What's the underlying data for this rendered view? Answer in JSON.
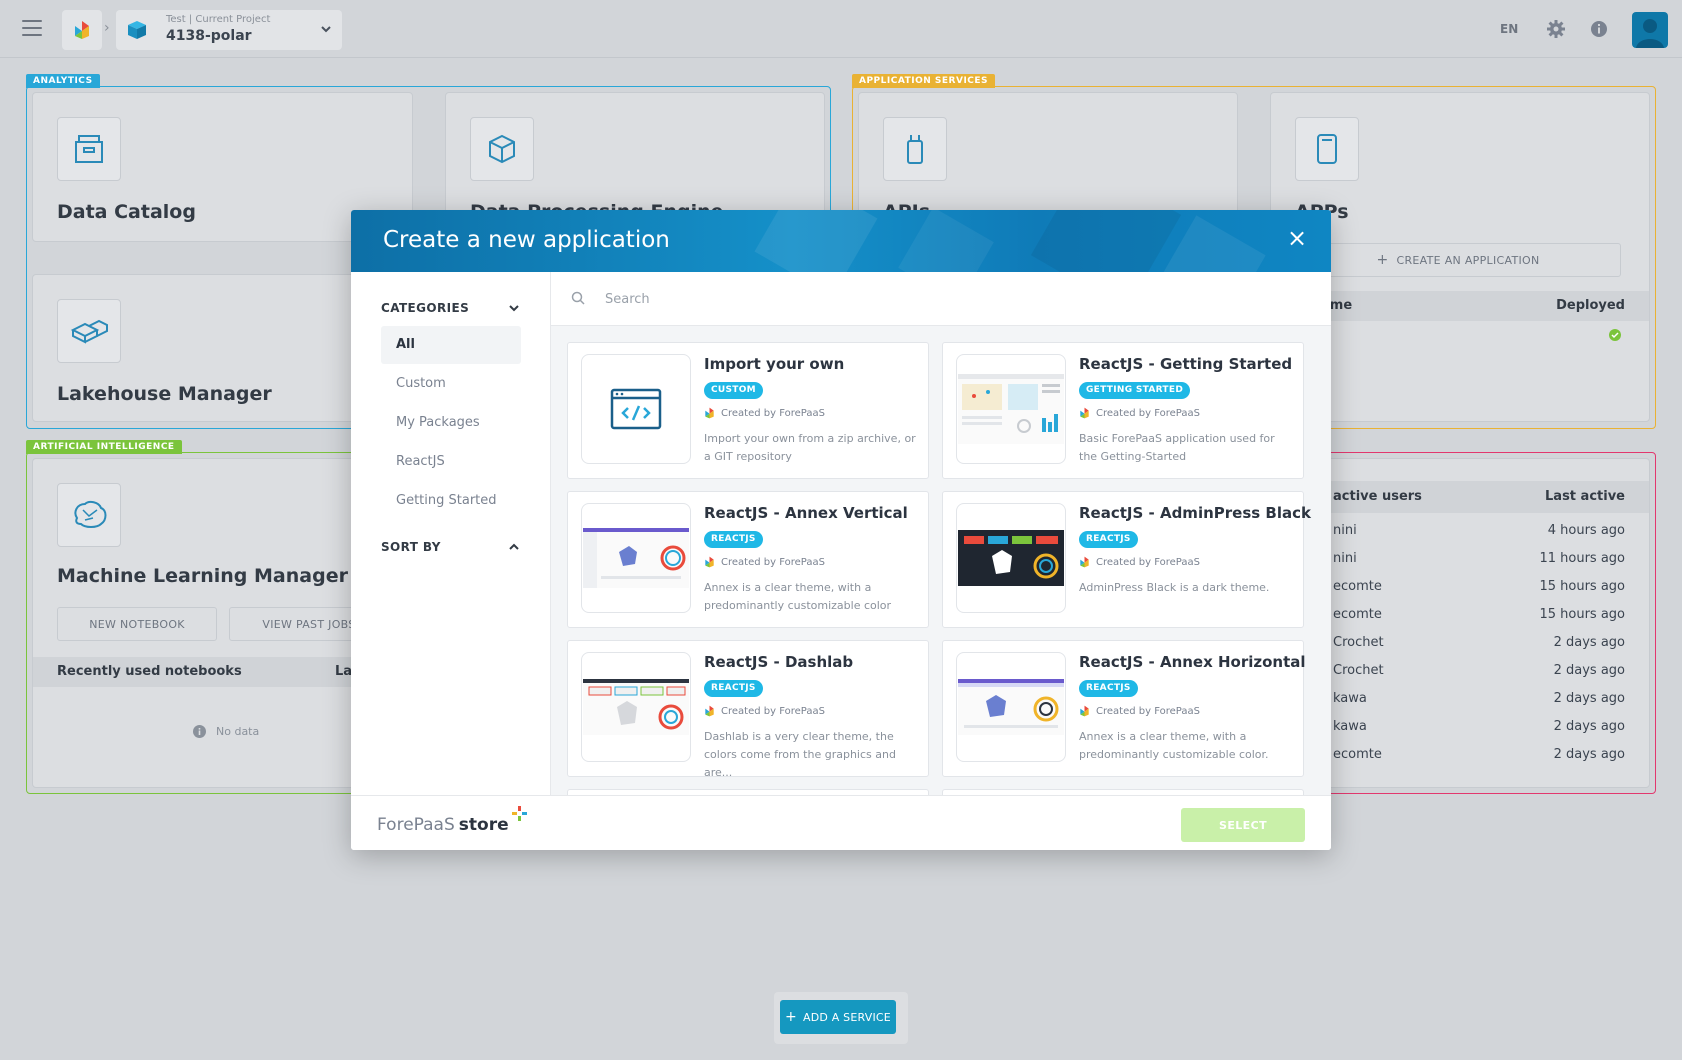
{
  "topbar": {
    "project_sub": "Test | Current Project",
    "project_name": "4138-polar",
    "lang": "EN"
  },
  "sections": {
    "analytics_tag": "ANALYTICS",
    "app_services_tag": "APPLICATION SERVICES",
    "ai_tag": "ARTIFICIAL INTELLIGENCE"
  },
  "cards": {
    "data_catalog": "Data Catalog",
    "data_processing": "Data Processing Engine",
    "lakehouse": "Lakehouse Manager",
    "apis": "APIs",
    "apps": "APPs",
    "create_app_label": "CREATE AN APPLICATION",
    "apps_table_name": "ame",
    "apps_table_deployed": "Deployed",
    "ml_manager": "Machine Learning Manager",
    "new_notebook": "NEW NOTEBOOK",
    "view_past_jobs": "VIEW PAST JOBS",
    "recent_notebooks": "Recently used notebooks",
    "recent_notebooks_col2": "La",
    "no_data": "No data"
  },
  "users": {
    "col_users": "active users",
    "col_last": "Last active",
    "rows": [
      {
        "name": "nini",
        "last": "4 hours ago"
      },
      {
        "name": "nini",
        "last": "11 hours ago"
      },
      {
        "name": "ecomte",
        "last": "15 hours ago"
      },
      {
        "name": "ecomte",
        "last": "15 hours ago"
      },
      {
        "name": "Crochet",
        "last": "2 days ago"
      },
      {
        "name": "Crochet",
        "last": "2 days ago"
      },
      {
        "name": "kawa",
        "last": "2 days ago"
      },
      {
        "name": "kawa",
        "last": "2 days ago"
      },
      {
        "name": "ecomte",
        "last": "2 days ago"
      }
    ]
  },
  "add_service": "ADD A SERVICE",
  "modal": {
    "title": "Create a new application",
    "categories_label": "CATEGORIES",
    "categories": [
      "All",
      "Custom",
      "My Packages",
      "ReactJS",
      "Getting Started"
    ],
    "sort_by_label": "SORT BY",
    "search_placeholder": "Search",
    "apps": [
      {
        "name": "Import your own",
        "badge": "CUSTOM",
        "author": "Created by ForePaaS",
        "desc": "Import your own from a zip archive, or a GIT repository"
      },
      {
        "name": "ReactJS - Getting Started",
        "badge": "GETTING STARTED",
        "author": "Created by ForePaaS",
        "desc": "Basic ForePaaS application used for the Getting-Started"
      },
      {
        "name": "ReactJS - Annex Vertical",
        "badge": "REACTJS",
        "author": "Created by ForePaaS",
        "desc": "Annex is a clear theme, with a predominantly customizable color"
      },
      {
        "name": "ReactJS - AdminPress Black",
        "badge": "REACTJS",
        "author": "Created by ForePaaS",
        "desc": "AdminPress Black is a dark theme."
      },
      {
        "name": "ReactJS - Dashlab",
        "badge": "REACTJS",
        "author": "Created by ForePaaS",
        "desc": "Dashlab is a very clear theme, the colors come from the graphics and are..."
      },
      {
        "name": "ReactJS - Annex Horizontal",
        "badge": "REACTJS",
        "author": "Created by ForePaaS",
        "desc": "Annex is a clear theme, with a predominantly customizable color."
      }
    ],
    "footer_brand": "ForePaaS",
    "footer_store": "store",
    "select_label": "SELECT"
  },
  "colors": {
    "analytics": "#29a7d8",
    "app_services": "#e9b234",
    "ai": "#7bc43c",
    "users_section": "#e2386e",
    "badge": "#1fb8e6",
    "select_disabled": "#c9f0a9"
  }
}
